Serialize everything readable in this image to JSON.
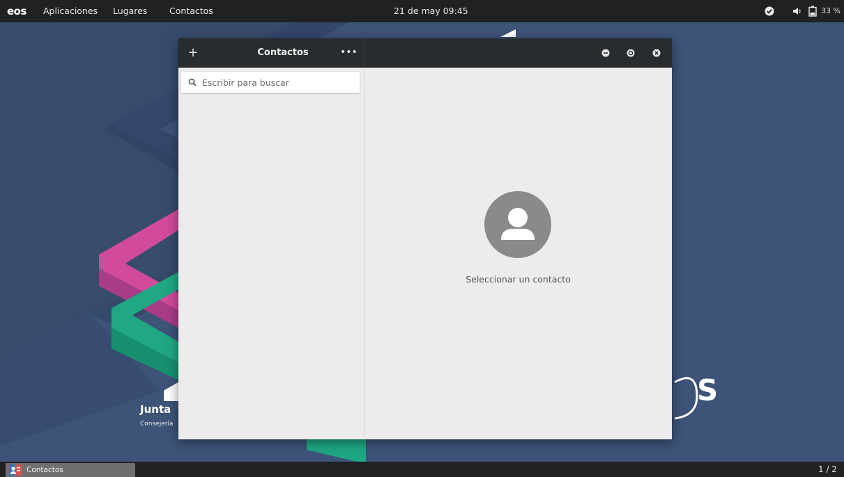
{
  "top_panel": {
    "logo": "eos",
    "menu_apps": "Aplicaciones",
    "menu_places": "Lugares",
    "menu_active_app": "Contactos",
    "clock": "21 de may  09:45",
    "battery_percent": "33 %"
  },
  "window": {
    "title": "Contactos",
    "add_icon": "plus-icon",
    "more_icon": "more-horizontal-icon",
    "search": {
      "placeholder": "Escribir para buscar",
      "value": ""
    },
    "empty_state_label": "Seleccionar un contacto",
    "avatar_icon": "person-avatar-icon"
  },
  "bottom_panel": {
    "taskbar_label": "Contactos",
    "workspace": "1 / 2"
  },
  "wallpaper": {
    "text_1": "Junta",
    "text_2": "Consejería",
    "text_3": "S"
  },
  "colors": {
    "panel": "#1f2122",
    "headerbar": "#282c2e",
    "window_bg": "#ececec",
    "desktop_bg": "#3d5378",
    "accent_pink": "#e8559a",
    "accent_green": "#22b688",
    "avatar": "#8a8a8a"
  }
}
